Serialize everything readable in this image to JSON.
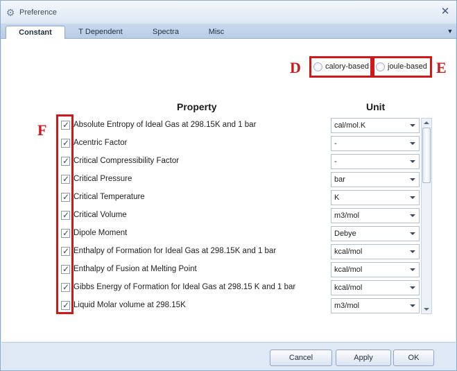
{
  "window": {
    "title": "Preference",
    "icon": "gear-icon"
  },
  "tabs": [
    {
      "label": "Constant",
      "active": true
    },
    {
      "label": "T Dependent",
      "active": false
    },
    {
      "label": "Spectra",
      "active": false
    },
    {
      "label": "Misc",
      "active": false
    }
  ],
  "markers": {
    "d": "D",
    "e": "E",
    "f": "F"
  },
  "basis": {
    "calory_label": "calory-based",
    "joule_label": "joule-based"
  },
  "table": {
    "property_header": "Property",
    "unit_header": "Unit",
    "rows": [
      {
        "property": "Absolute Entropy of Ideal Gas at 298.15K and 1 bar",
        "unit": "cal/mol.K",
        "checked": true
      },
      {
        "property": "Acentric Factor",
        "unit": "-",
        "checked": true
      },
      {
        "property": "Critical Compressibility Factor",
        "unit": "-",
        "checked": true
      },
      {
        "property": "Critical Pressure",
        "unit": "bar",
        "checked": true
      },
      {
        "property": "Critical Temperature",
        "unit": "K",
        "checked": true
      },
      {
        "property": "Critical Volume",
        "unit": "m3/mol",
        "checked": true
      },
      {
        "property": "Dipole Moment",
        "unit": "Debye",
        "checked": true
      },
      {
        "property": "Enthalpy of Formation for Ideal Gas at 298.15K and 1 bar",
        "unit": "kcal/mol",
        "checked": true
      },
      {
        "property": "Enthalpy of Fusion at Melting Point",
        "unit": "kcal/mol",
        "checked": true
      },
      {
        "property": "Gibbs Energy of Formation for Ideal Gas at 298.15 K and 1 bar",
        "unit": "kcal/mol",
        "checked": true
      },
      {
        "property": "Liquid Molar volume at 298.15K",
        "unit": "m3/mol",
        "checked": true
      }
    ]
  },
  "buttons": {
    "cancel": "Cancel",
    "apply": "Apply",
    "ok": "OK"
  },
  "colors": {
    "accent_red": "#d01818",
    "frame": "#dfe8f5"
  }
}
